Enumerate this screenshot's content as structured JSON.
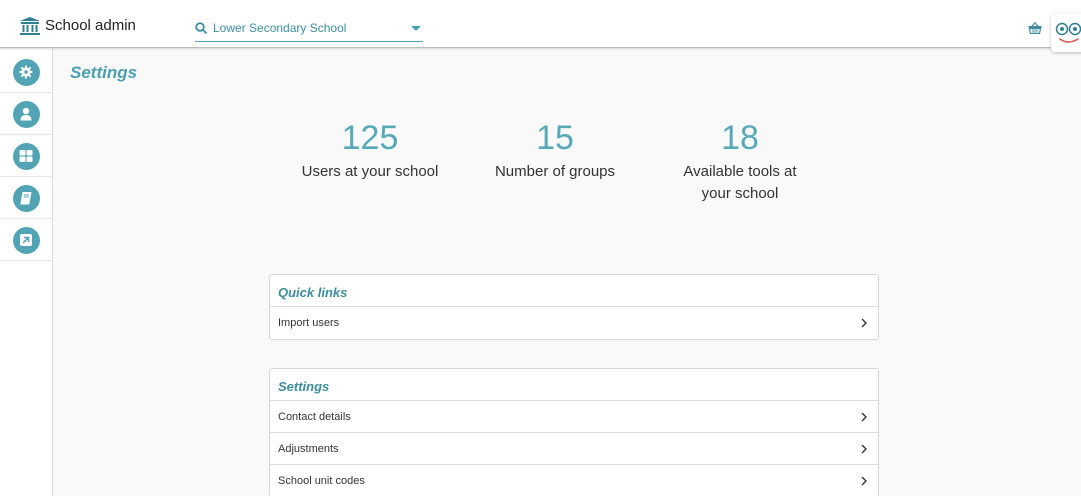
{
  "header": {
    "title": "School admin",
    "school_selector": {
      "value": "Lower Secondary School"
    }
  },
  "icons": {
    "brand": "school-building-icon",
    "search": "search-icon",
    "basket": "basket-icon",
    "mascot": "mascot-face-icon"
  },
  "sidebar": {
    "items": [
      {
        "icon": "gear-icon"
      },
      {
        "icon": "user-icon"
      },
      {
        "icon": "grid-icon"
      },
      {
        "icon": "book-icon"
      },
      {
        "icon": "external-link-icon"
      }
    ]
  },
  "page": {
    "title": "Settings"
  },
  "stats": [
    {
      "value": "125",
      "label": "Users at your school"
    },
    {
      "value": "15",
      "label": "Number of groups"
    },
    {
      "value": "18",
      "label": "Available tools at your school"
    }
  ],
  "quick_links": {
    "title": "Quick links",
    "items": [
      "Import users"
    ]
  },
  "settings_card": {
    "title": "Settings",
    "items": [
      "Contact details",
      "Adjustments",
      "School unit codes"
    ]
  },
  "colors": {
    "accent": "#52a4b4",
    "accent_text": "#3e8ea0",
    "background": "#f9f9f9"
  }
}
